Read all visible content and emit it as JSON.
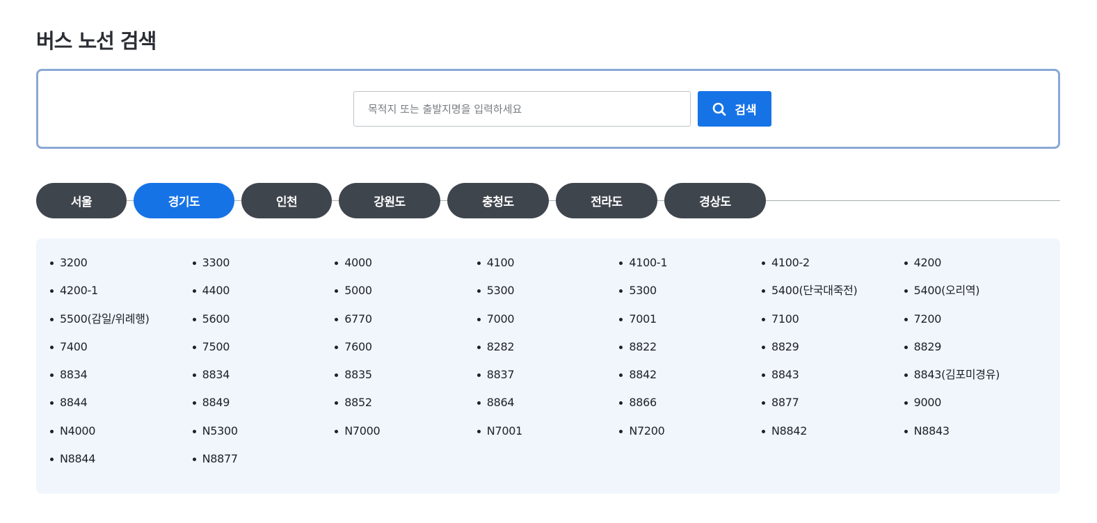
{
  "page": {
    "title": "버스 노선 검색"
  },
  "search": {
    "placeholder": "목적지 또는 출발지명을 입력하세요",
    "value": "",
    "button_label": "검색"
  },
  "tabs": [
    {
      "label": "서울",
      "active": false
    },
    {
      "label": "경기도",
      "active": true
    },
    {
      "label": "인천",
      "active": false
    },
    {
      "label": "강원도",
      "active": false
    },
    {
      "label": "충청도",
      "active": false
    },
    {
      "label": "전라도",
      "active": false
    },
    {
      "label": "경상도",
      "active": false
    }
  ],
  "routes": [
    "3200",
    "3300",
    "4000",
    "4100",
    "4100-1",
    "4100-2",
    "4200",
    "4200-1",
    "4400",
    "5000",
    "5300",
    "5300",
    "5400(단국대죽전)",
    "5400(오리역)",
    "5500(감일/위례행)",
    "5600",
    "6770",
    "7000",
    "7001",
    "7100",
    "7200",
    "7400",
    "7500",
    "7600",
    "8282",
    "8822",
    "8829",
    "8829",
    "8834",
    "8834",
    "8835",
    "8837",
    "8842",
    "8843",
    "8843(김포미경유)",
    "8844",
    "8849",
    "8852",
    "8864",
    "8866",
    "8877",
    "9000",
    "N4000",
    "N5300",
    "N7000",
    "N7001",
    "N7200",
    "N8842",
    "N8843",
    "N8844",
    "N8877"
  ],
  "colors": {
    "accent": "#1673e6",
    "tab_inactive": "#3f454d",
    "panel_bg": "#f1f5fc",
    "search_border": "#8aa8d4"
  },
  "icons": {
    "search_button": "search-icon"
  }
}
